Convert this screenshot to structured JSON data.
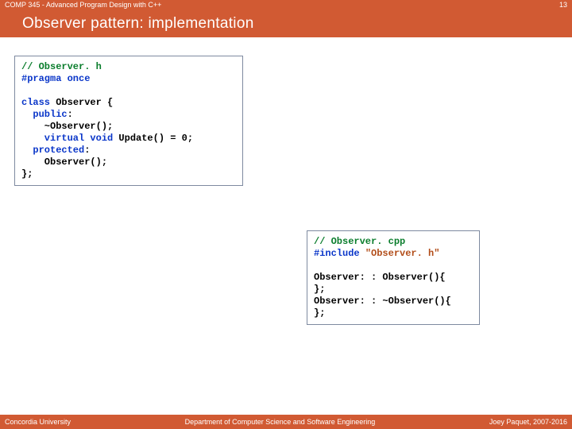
{
  "header": {
    "course": "COMP 345 - Advanced Program Design with C++",
    "page": "13",
    "title": "Observer pattern: implementation"
  },
  "code_h": {
    "c1": "// Observer. h",
    "pp1": "#pragma once",
    "blank1": "",
    "l1a": "class",
    "l1b": " Observer {",
    "l2a": "  public",
    "l2b": ":",
    "l3": "    ~Observer();",
    "l4a": "    virtual void",
    "l4b": " Update() = 0;",
    "l5a": "  protected",
    "l5b": ":",
    "l6": "    Observer();",
    "l7": "};"
  },
  "code_cpp": {
    "c1": "// Observer. cpp",
    "pp1a": "#include ",
    "pp1b": "\"Observer. h\"",
    "blank1": "",
    "l1": "Observer: : Observer(){",
    "l2": "};",
    "l3": "Observer: : ~Observer(){",
    "l4": "};"
  },
  "footer": {
    "left": "Concordia University",
    "center": "Department of Computer Science and Software Engineering",
    "right": "Joey Paquet, 2007-2016"
  }
}
